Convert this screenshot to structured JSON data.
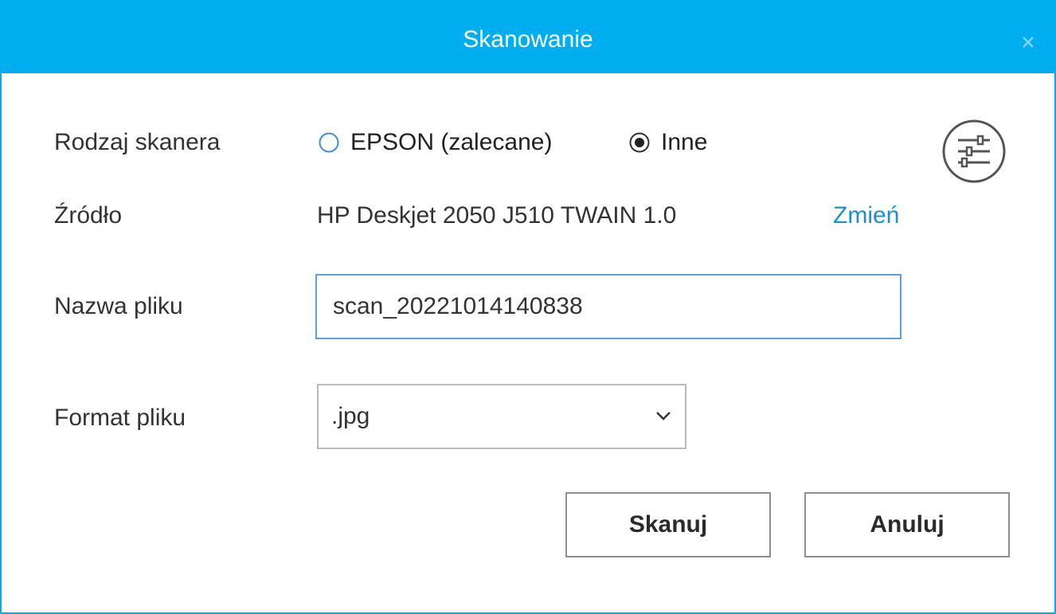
{
  "window": {
    "title": "Skanowanie",
    "close_icon": "close-icon"
  },
  "scanner_type": {
    "label": "Rodzaj skanera",
    "options": [
      {
        "label": "EPSON (zalecane)",
        "selected": false
      },
      {
        "label": "Inne",
        "selected": true
      }
    ]
  },
  "settings_icon": "sliders-settings-icon",
  "source": {
    "label": "Źródło",
    "value": "HP Deskjet 2050 J510 TWAIN 1.0",
    "change_link": "Zmień"
  },
  "filename": {
    "label": "Nazwa pliku",
    "value": "scan_20221014140838"
  },
  "format": {
    "label": "Format pliku",
    "selected": ".jpg"
  },
  "buttons": {
    "scan": "Skanuj",
    "cancel": "Anuluj"
  },
  "colors": {
    "accent": "#00aeef",
    "link": "#1a8fd6"
  }
}
